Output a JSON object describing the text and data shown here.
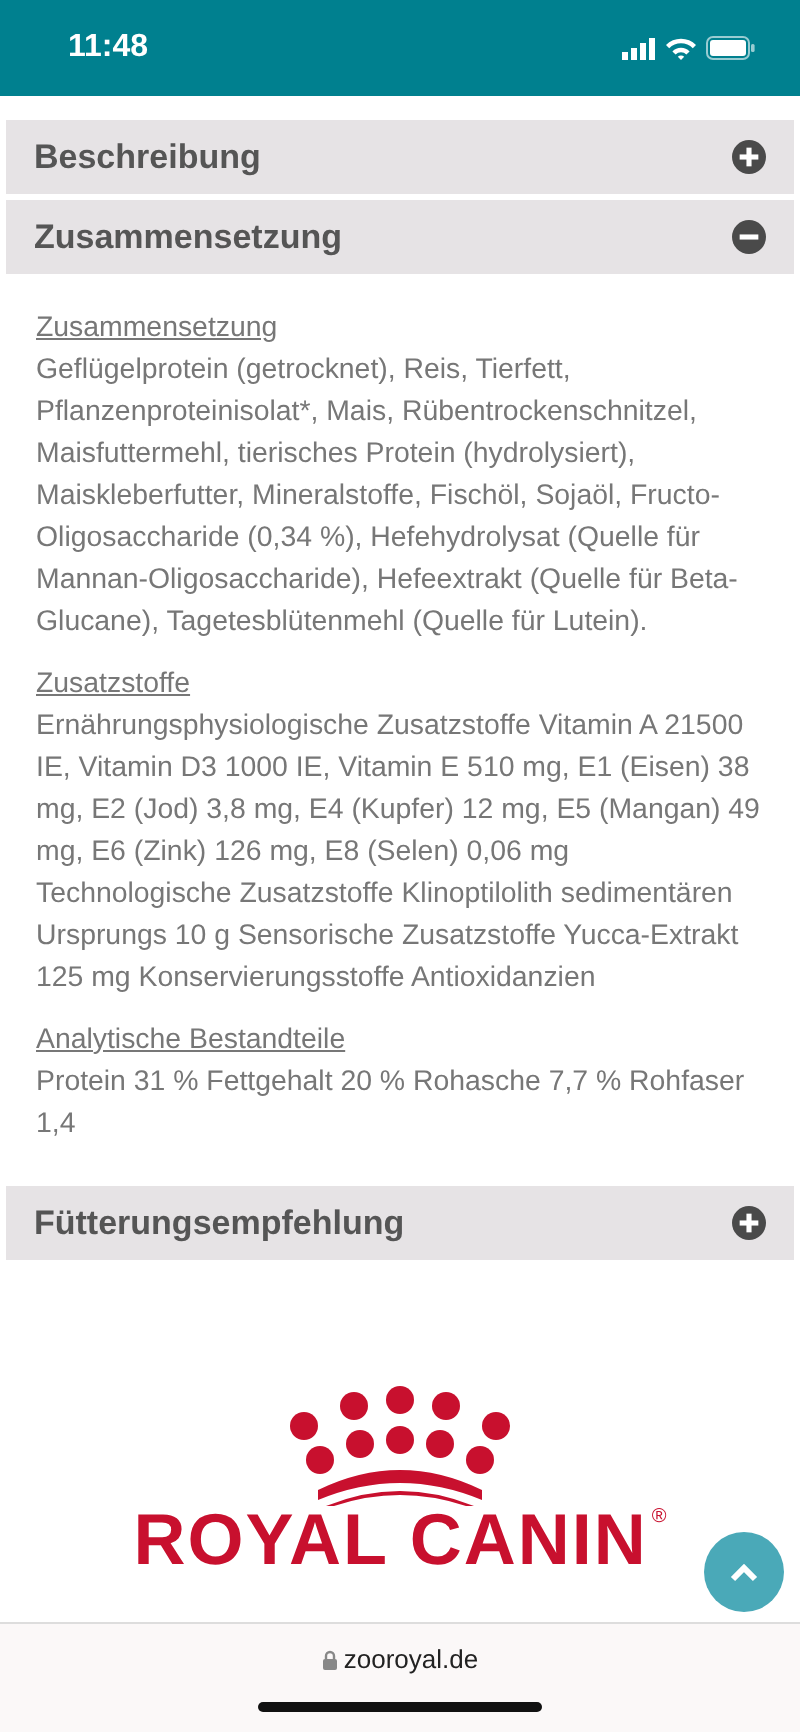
{
  "status_bar": {
    "time": "11:48"
  },
  "accordion": [
    {
      "label": "Beschreibung",
      "expanded": false
    },
    {
      "label": "Zusammensetzung",
      "expanded": true,
      "sections": [
        {
          "heading": "Zusammensetzung",
          "text": "Geflügelprotein (getrocknet), Reis, Tierfett, Pflanzenproteinisolat*, Mais, Rübentrockenschnitzel, Maisfuttermehl, tierisches Protein (hydrolysiert), Maiskleberfutter, Mineralstoffe, Fischöl, Sojaöl, Fructo-Oligosaccharide (0,34 %), Hefehydrolysat (Quelle für Mannan-Oligosaccharide), Hefeextrakt (Quelle für Beta-Glucane), Tagetesblütenmehl (Quelle für Lutein)."
        },
        {
          "heading": "Zusatzstoffe",
          "text": "Ernährungsphysiologische Zusatzstoffe Vitamin A 21500 IE, Vitamin D3 1000 IE, Vitamin E 510 mg, E1 (Eisen) 38 mg, E2 (Jod) 3,8 mg, E4 (Kupfer) 12 mg, E5 (Mangan) 49 mg, E6 (Zink) 126 mg, E8 (Selen) 0,06 mg Technologische Zusatzstoffe Klinoptilolith sedimentären Ursprungs 10 g Sensorische Zusatzstoffe Yucca-Extrakt 125 mg Konservierungsstoffe Antioxidanzien"
        },
        {
          "heading": "Analytische Bestandteile",
          "text": "Protein 31 % Fettgehalt 20 % Rohasche 7,7 % Rohfaser 1,4"
        }
      ]
    },
    {
      "label": "Fütterungsempfehlung",
      "expanded": false
    }
  ],
  "brand_logo": {
    "text": "ROYAL CANIN",
    "mark": "®"
  },
  "browser_bar": {
    "url": "zooroyal.de"
  }
}
